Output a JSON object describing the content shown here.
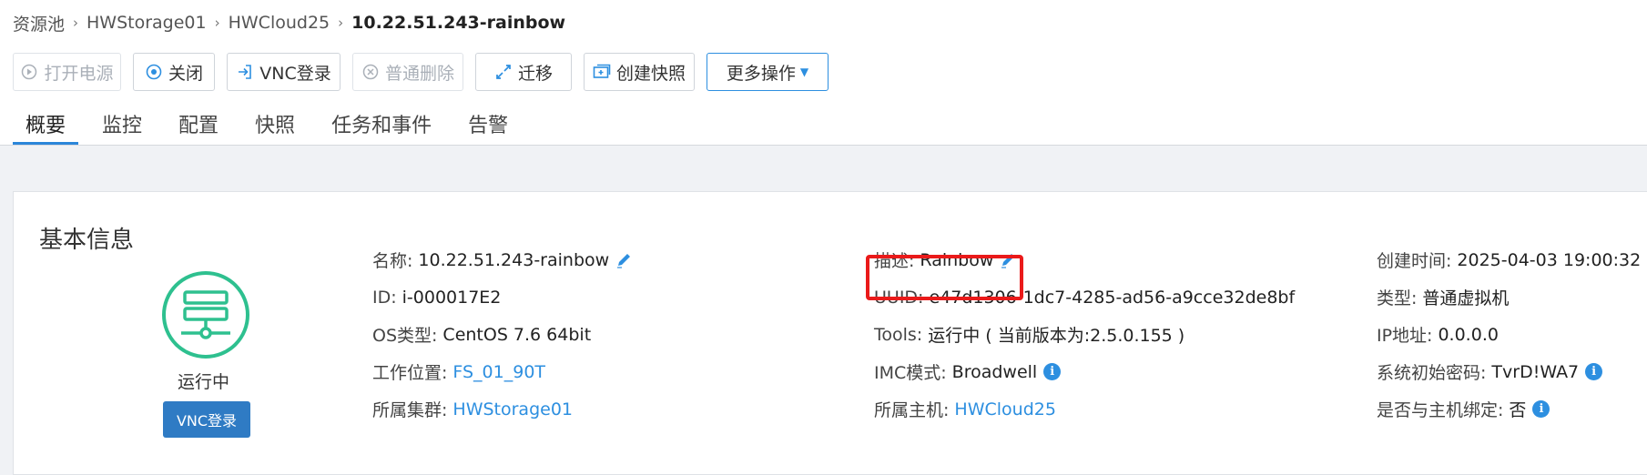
{
  "breadcrumb": {
    "items": [
      "资源池",
      "HWStorage01",
      "HWCloud25"
    ],
    "current": "10.22.51.243-rainbow"
  },
  "toolbar": {
    "buttons": [
      {
        "label": "打开电源",
        "icon": "play-circle-icon",
        "disabled": true
      },
      {
        "label": "关闭",
        "icon": "stop-circle-icon",
        "disabled": false
      },
      {
        "label": "VNC登录",
        "icon": "login-icon",
        "disabled": false
      },
      {
        "label": "普通删除",
        "icon": "close-circle-icon",
        "disabled": true
      },
      {
        "label": "迁移",
        "icon": "migrate-arrows-icon",
        "disabled": false
      },
      {
        "label": "创建快照",
        "icon": "snapshot-icon",
        "disabled": false
      },
      {
        "label": "更多操作",
        "icon": "caret-down-icon",
        "disabled": false
      }
    ]
  },
  "tabs": [
    {
      "label": "概要",
      "active": true
    },
    {
      "label": "监控",
      "active": false
    },
    {
      "label": "配置",
      "active": false
    },
    {
      "label": "快照",
      "active": false
    },
    {
      "label": "任务和事件",
      "active": false
    },
    {
      "label": "告警",
      "active": false
    }
  ],
  "basic_info": {
    "title": "基本信息",
    "status": "运行中",
    "vnc_button": "VNC登录",
    "status_icon": "vm-server-icon",
    "col1": {
      "name_label": "名称:",
      "name_value": "10.22.51.243-rainbow",
      "id_label": "ID:",
      "id_value": "i-000017E2",
      "os_label": "OS类型:",
      "os_value": "CentOS 7.6 64bit",
      "location_label": "工作位置:",
      "location_value": "FS_01_90T",
      "cluster_label": "所属集群:",
      "cluster_value": "HWStorage01"
    },
    "col2": {
      "desc_label": "描述:",
      "desc_value": "Rainbow",
      "uuid_label": "UUID:",
      "uuid_value": "e47d1306-1dc7-4285-ad56-a9cce32de8bf",
      "tools_label": "Tools:",
      "tools_value": "运行中 ( 当前版本为:2.5.0.155 )",
      "imc_label": "IMC模式:",
      "imc_value": "Broadwell",
      "host_label": "所属主机:",
      "host_value": "HWCloud25"
    },
    "col3": {
      "created_label": "创建时间:",
      "created_value": "2025-04-03 19:00:32",
      "type_label": "类型:",
      "type_value": "普通虚拟机",
      "ip_label": "IP地址:",
      "ip_value": "0.0.0.0",
      "pwd_label": "系统初始密码:",
      "pwd_value": "TvrD!WA7",
      "bind_label": "是否与主机绑定:",
      "bind_value": "否"
    }
  },
  "colors": {
    "accent": "#2d8fe0",
    "status_green": "#2ec08f",
    "highlight_red": "#ea1a1a",
    "vnc_button": "#2f7bc4"
  }
}
